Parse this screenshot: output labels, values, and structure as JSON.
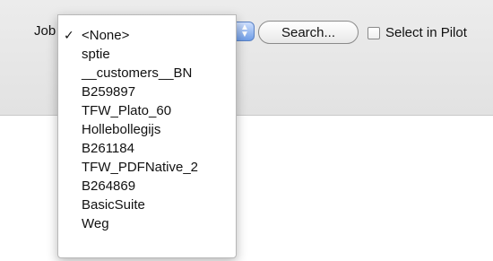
{
  "toolbar": {
    "job_label": "Job",
    "search_label": "Search...",
    "select_in_pilot_label": "Select in Pilot",
    "select_in_pilot_checked": false
  },
  "menu": {
    "items": [
      {
        "label": "<None>",
        "checked": true
      },
      {
        "label": "sptie",
        "checked": false
      },
      {
        "label": "__customers__BN",
        "checked": false
      },
      {
        "label": "B259897",
        "checked": false
      },
      {
        "label": "TFW_Plato_60",
        "checked": false
      },
      {
        "label": "Hollebollegijs",
        "checked": false
      },
      {
        "label": "B261184",
        "checked": false
      },
      {
        "label": "TFW_PDFNative_2",
        "checked": false
      },
      {
        "label": "B264869",
        "checked": false
      },
      {
        "label": "BasicSuite",
        "checked": false
      },
      {
        "label": "Weg",
        "checked": false
      }
    ],
    "check_glyph": "✓"
  },
  "colors": {
    "popup_accent": "#6f9de6",
    "toolbar_bg": "#e6e6e6"
  }
}
